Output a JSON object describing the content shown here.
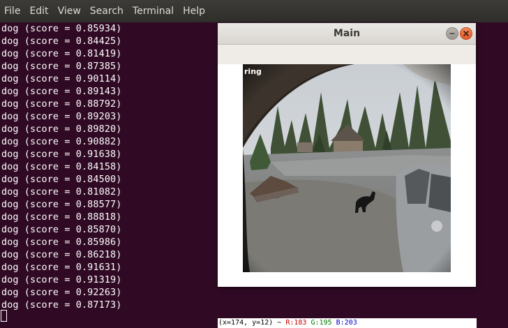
{
  "menubar": {
    "items": [
      "File",
      "Edit",
      "View",
      "Search",
      "Terminal",
      "Help"
    ]
  },
  "terminal": {
    "lines": [
      "dog (score = 0.85934)",
      "dog (score = 0.84425)",
      "dog (score = 0.81419)",
      "dog (score = 0.87385)",
      "dog (score = 0.90114)",
      "dog (score = 0.89143)",
      "dog (score = 0.88792)",
      "dog (score = 0.89203)",
      "dog (score = 0.89820)",
      "dog (score = 0.90882)",
      "dog (score = 0.91638)",
      "dog (score = 0.84158)",
      "dog (score = 0.84500)",
      "dog (score = 0.81082)",
      "dog (score = 0.88577)",
      "dog (score = 0.88818)",
      "dog (score = 0.85870)",
      "dog (score = 0.85986)",
      "dog (score = 0.86218)",
      "dog (score = 0.91631)",
      "dog (score = 0.91319)",
      "dog (score = 0.92263)",
      "dog (score = 0.87173)"
    ]
  },
  "window": {
    "title": "Main",
    "watermark": "ring",
    "status": {
      "coords": "(x=174, y=12) ~ ",
      "r": "R:183",
      "g": "G:195",
      "b": "B:203"
    }
  },
  "colors": {
    "terminal_bg": "#300a24",
    "menubar_bg": "#3c3b37",
    "close_button": "#e5592a"
  },
  "icons": [
    "minimize-icon",
    "close-icon",
    "cursor-icon"
  ]
}
